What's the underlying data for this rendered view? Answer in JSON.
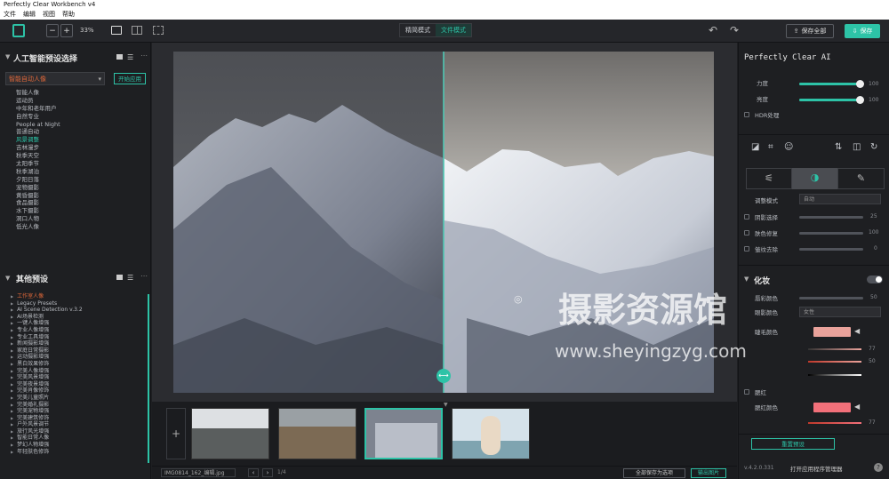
{
  "app": {
    "title": "Perfectly Clear Workbench v4",
    "menu": [
      "文件",
      "编辑",
      "视图",
      "帮助"
    ]
  },
  "toolbar": {
    "zoom_minus": "−",
    "zoom_plus": "+",
    "zoom_value": "33%",
    "modes": [
      "精简模式",
      "文件模式"
    ],
    "save_all": "保存全部",
    "save": "保存",
    "undo_icon": "undo-icon",
    "redo_icon": "redo-icon"
  },
  "left": {
    "ai_title": "人工智能预设选择",
    "preset_select": "智能自动人像",
    "apply": "开始应用",
    "ai_presets": [
      "智能人像",
      "运动员",
      "中年和老年用户",
      "自然专业",
      "People at Night",
      "普通自动",
      "风景调整",
      "吉林漫步",
      "秋季天空",
      "太阳季节",
      "秋季湖泊",
      "夕阳日落",
      "宠物摄影",
      "黄昏摄影",
      "食品摄影",
      "水下摄影",
      "洞口人物",
      "低光人像"
    ],
    "ai_highlight_index": 6,
    "preset_title": "其他预设",
    "presets": [
      "工作室人像",
      "Legacy Presets",
      "AI Scene Detection v.3.2",
      "AI场景检测",
      "一键人像增强",
      "专业人像增强",
      "专业工具增强",
      "新闻摄影增强",
      "家庭日常摄影",
      "运动摄影增强",
      "黑白效果修饰",
      "完美人像增强",
      "完美风景增强",
      "完美夜景增强",
      "完美肖像修饰",
      "完美儿童照片",
      "完美婚礼摄影",
      "完美宠物增强",
      "完美建筑修饰",
      "户外风景调节",
      "旅行风光增强",
      "智能日常人像",
      "梦幻人物增强",
      "年轻肤色修饰"
    ],
    "preset_highlight_index": 0
  },
  "statusbar": {
    "filename": "IMG0814_162_编辑.jpg",
    "count": "1/4",
    "save_current": "全部保存为选项",
    "export": "输出图片"
  },
  "right": {
    "title": "Perfectly Clear AI",
    "strength_label": "力度",
    "strength_value": "100",
    "light_label": "亮度",
    "light_value": "100",
    "hdr_label": "HDR处理",
    "row1": "调整模式",
    "row1_val": "自动",
    "row2": "阴影选择",
    "row2_val": "25",
    "row3": "肤色修复",
    "row3_val": "100",
    "row4": "皱纹去除",
    "row4_val": "0",
    "makeup_title": "化妆",
    "makeup_rows": [
      "唇彩颜色",
      "眼影颜色",
      "睫毛颜色"
    ],
    "makeup_select": "女性",
    "row_a_val": "50",
    "row_b_val": "77",
    "row_c_val": "50",
    "row_d_val": "77",
    "blush_label": "腮红",
    "blush_color_label": "腮红颜色",
    "reset": "重置预设",
    "version": "v.4.2.0.331",
    "footer": "打开应用程序管理器",
    "colors": {
      "accent": "#2dc3a7",
      "swatch1": "#e9a29b",
      "swatch2": "#f2707a"
    }
  },
  "watermark": {
    "main": "摄影资源馆",
    "url": "www.sheyingzyg.com"
  }
}
